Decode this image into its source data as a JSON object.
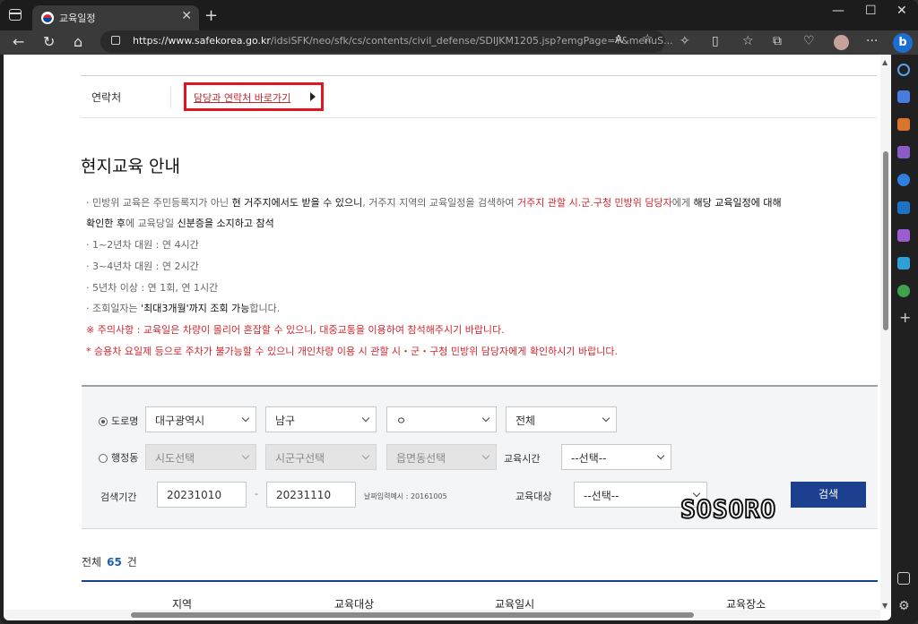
{
  "browser": {
    "tab_title": "교육일정",
    "url_domain": "https://www.safekorea.go.kr",
    "url_path": "/idsiSFK/neo/sfk/cs/contents/civil_defense/SDIJKM1205.jsp?emgPage=Y&menuS..."
  },
  "contact": {
    "label": "연락처",
    "link_text": "담당과 연락처 바로가기"
  },
  "section": {
    "title": "현지교육 안내"
  },
  "info": {
    "line1_a": "· 민방위 교육은 주민등록지가 아닌 ",
    "line1_b": "현 거주지에서도 받을 수 있으니",
    "line1_c": ", 거주지 지역의 교육일정을 검색하여 ",
    "line1_d": "거주지 관할 시.군.구청 민방위 담당자",
    "line1_e": "에게 ",
    "line1_f": "해당 교육일정에 대해",
    "line2_a": "확인한 후",
    "line2_b": "에 교육당일 ",
    "line2_c": "신분증을 소지하고 참석",
    "line3": "· 1~2년차 대원 : 연 4시간",
    "line4": "· 3~4년차 대원 : 연 2시간",
    "line5": "· 5년차 이상 : 연 1회, 연 1시간",
    "line6_a": "· 조회일자는 ",
    "line6_b": "'최대3개월'까지 조회 가능",
    "line6_c": "합니다.",
    "warning1": "※ 주의사항 : 교육일은 차량이 몰리어 혼잡할 수 있으니, 대중교통을 이용하여 참석해주시기 바랍니다.",
    "warning2": "* 승용차 요일제 등으로 주차가 불가능할 수 있으니 개인차량 이용 시 관할 시・군・구청 민방위 담당자에게 확인하시기 바랍니다."
  },
  "search": {
    "road_label": "도로명",
    "admin_label": "행정동",
    "road_city": "대구광역시",
    "road_district": "남구",
    "road_street": "ㅇ",
    "road_all": "전체",
    "admin_city": "시도선택",
    "admin_district": "시군구선택",
    "admin_town": "읍면동선택",
    "edu_time_label": "교육시간",
    "edu_time_value": "--선택--",
    "period_label": "검색기간",
    "start_date": "20231010",
    "separator": "-",
    "end_date": "20231110",
    "date_hint": "날짜입력예시 : 20161005",
    "target_label": "교육대상",
    "target_value": "--선택--",
    "search_button": "검색"
  },
  "watermark": "SOSORO",
  "results": {
    "total_label": "전체",
    "total_count": "65",
    "total_unit": "건",
    "columns": [
      "지역",
      "교육대상",
      "교육일시",
      "교육장소"
    ]
  },
  "colors": {
    "accent_navy": "#1d3f8f",
    "highlight_red": "#d0262e",
    "callout_border": "#e0151f"
  }
}
